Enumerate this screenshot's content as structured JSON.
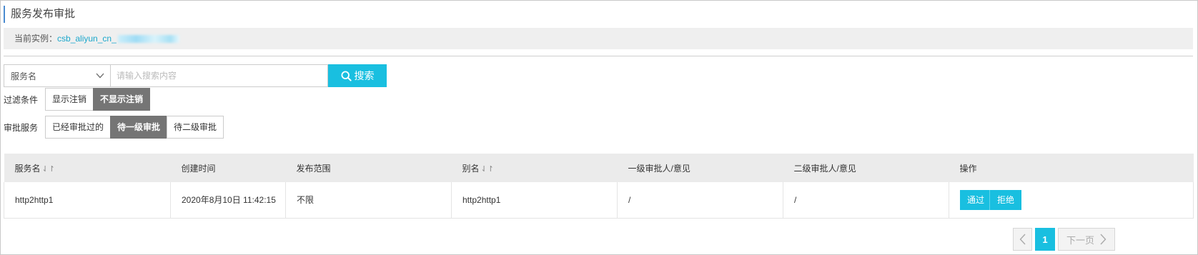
{
  "page": {
    "title": "服务发布审批"
  },
  "instance": {
    "label": "当前实例：",
    "value": "csb_aliyun_cn_"
  },
  "search": {
    "field_select_value": "服务名",
    "placeholder": "请输入搜索内容",
    "button_label": "搜索"
  },
  "filter": {
    "label": "过滤条件",
    "options": [
      "显示注销",
      "不显示注销"
    ],
    "active_index": 1
  },
  "approval": {
    "label": "审批服务",
    "options": [
      "已经审批过的",
      "待一级审批",
      "待二级审批"
    ],
    "active_index": 1
  },
  "table": {
    "columns": [
      "服务名",
      "创建时间",
      "发布范围",
      "别名",
      "一级审批人/意见",
      "二级审批人/意见",
      "操作"
    ],
    "sort_icon": "⇃↾",
    "rows": [
      {
        "service_name": "http2http1",
        "created": "2020年8月10日 11:42:15",
        "scope": "不限",
        "alias": "http2http1",
        "level1": "/",
        "level2": "/",
        "actions": [
          "通过",
          "拒绝"
        ]
      }
    ]
  },
  "pagination": {
    "current_page": "1",
    "next_label": "下一页"
  },
  "colors": {
    "accent": "#19bfe0",
    "active_segment": "#757575",
    "title_bar": "#4a8bd0"
  }
}
